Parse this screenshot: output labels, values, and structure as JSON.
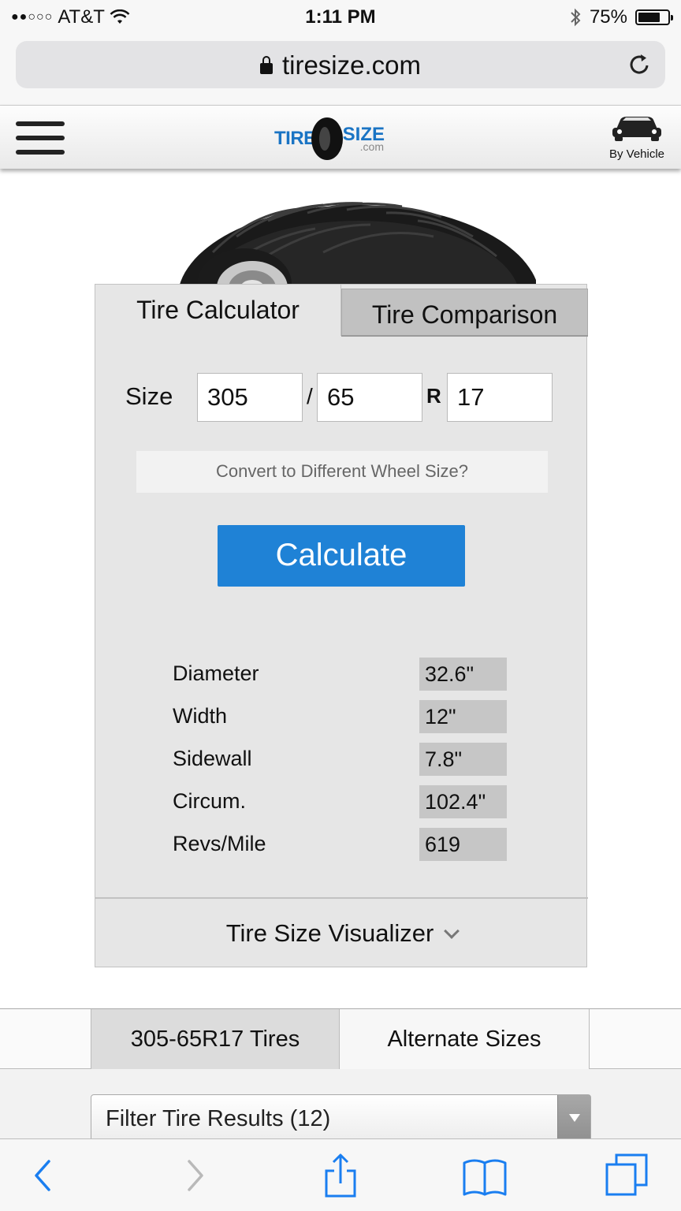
{
  "status_bar": {
    "carrier": "AT&T",
    "time": "1:11 PM",
    "battery": "75%",
    "battery_level": 0.75
  },
  "browser": {
    "url": "tiresize.com"
  },
  "site": {
    "logo_tire": "TIRE",
    "logo_size": "SIZE",
    "logo_com": ".com",
    "by_vehicle_label": "By Vehicle"
  },
  "calculator": {
    "tabs": [
      "Tire Calculator",
      "Tire Comparison"
    ],
    "size_label": "Size",
    "width_value": "305",
    "separator": "/",
    "aspect_value": "65",
    "construction": "R",
    "rim_value": "17",
    "convert_label": "Convert to Different Wheel Size?",
    "calculate_label": "Calculate",
    "results": [
      {
        "label": "Diameter",
        "value": "32.6\""
      },
      {
        "label": "Width",
        "value": "12\""
      },
      {
        "label": "Sidewall",
        "value": "7.8\""
      },
      {
        "label": "Circum.",
        "value": "102.4\""
      },
      {
        "label": "Revs/Mile",
        "value": "619"
      }
    ],
    "visualizer_label": "Tire Size Visualizer"
  },
  "lower": {
    "tabs": [
      "305-65R17 Tires",
      "Alternate Sizes"
    ],
    "filter_label": "Filter Tire Results (12)"
  },
  "icons": {
    "status": [
      "signal-icon",
      "wifi-icon",
      "bluetooth-icon",
      "battery-icon"
    ],
    "toolbar": [
      "back-icon",
      "forward-icon",
      "share-icon",
      "bookmarks-icon",
      "tabs-icon"
    ],
    "accent": "#1f82d6",
    "toolbar_blue": "#1a7ef0",
    "logo_blue": "#1a74c4"
  }
}
